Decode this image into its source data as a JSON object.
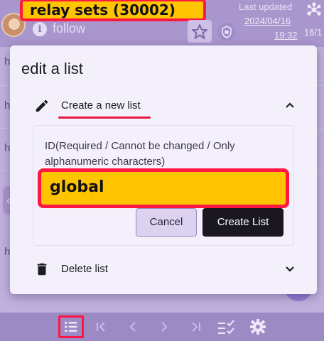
{
  "header": {
    "relay_sets_label": "relay sets (30002)",
    "follow_label": "follow",
    "last_updated_label": "Last updated",
    "last_updated_date": "2024/04/16",
    "last_updated_time": "19:32",
    "side_count": "16/1"
  },
  "background_rows": [
    "h",
    "h",
    "h",
    "h"
  ],
  "modal": {
    "title": "edit a list",
    "create_section": {
      "label": "Create a new list",
      "id_label": "ID(Required / Cannot be changed / Only alphanumeric characters)",
      "id_value": "global",
      "cancel_label": "Cancel",
      "create_label": "Create List"
    },
    "delete_section": {
      "label": "Delete list"
    }
  },
  "colors": {
    "highlight_fill": "#ffc400",
    "highlight_border": "#ff1744",
    "accent_purple": "#9b8ac4",
    "primary_button": "#1a1720"
  },
  "icons": [
    "network-icon",
    "star-icon",
    "shield-icon",
    "info-icon",
    "pencil-icon",
    "chevron-up-icon",
    "trash-icon",
    "chevron-down-icon",
    "list-icon",
    "first-page-icon",
    "prev-page-icon",
    "next-page-icon",
    "last-page-icon",
    "checklist-icon",
    "gear-icon"
  ]
}
